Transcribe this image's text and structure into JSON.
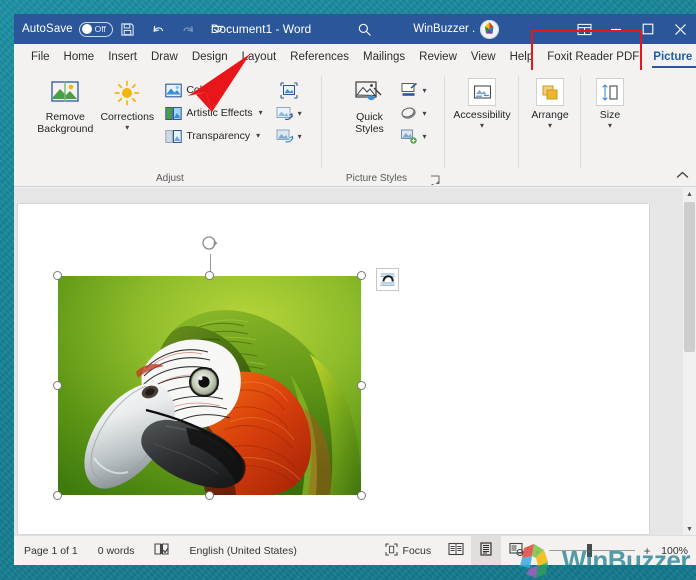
{
  "titlebar": {
    "autosave_label": "AutoSave",
    "autosave_state": "Off",
    "save_icon": "save-icon",
    "undo_icon": "undo-icon",
    "redo_icon": "redo-icon",
    "customize_qat_icon": "chevron-down-icon",
    "document_title": "Document1  -  Word",
    "search_icon": "search-icon",
    "account_name": "WinBuzzer .",
    "ribbon_display_icon": "ribbon-display-options-icon",
    "minimize_icon": "minimize-icon",
    "maximize_icon": "maximize-icon",
    "close_icon": "close-icon"
  },
  "tabs": [
    {
      "label": "File",
      "active": false
    },
    {
      "label": "Home",
      "active": false
    },
    {
      "label": "Insert",
      "active": false
    },
    {
      "label": "Draw",
      "active": false
    },
    {
      "label": "Design",
      "active": false
    },
    {
      "label": "Layout",
      "active": false
    },
    {
      "label": "References",
      "active": false
    },
    {
      "label": "Mailings",
      "active": false
    },
    {
      "label": "Review",
      "active": false
    },
    {
      "label": "View",
      "active": false
    },
    {
      "label": "Help",
      "active": false
    },
    {
      "label": "Foxit Reader PDF",
      "active": false
    },
    {
      "label": "Picture Format",
      "active": true
    }
  ],
  "tabstrip_right": {
    "share_icon": "share-icon",
    "comments_icon": "comments-icon"
  },
  "annotations": {
    "highlight_box_target": "Picture Format",
    "highlight_color": "#e8161b",
    "arrow_color": "#e8161b",
    "arrow_target": "Color"
  },
  "ribbon": {
    "collapse_icon": "chevron-up-icon",
    "groups": [
      {
        "name": "adjust",
        "label": "Adjust",
        "big_buttons": [
          {
            "label": "Remove\nBackground",
            "label_line1": "Remove",
            "label_line2": "Background",
            "icon": "remove-background-icon",
            "has_chevron": false
          },
          {
            "label": "Corrections",
            "icon": "corrections-sun-icon",
            "has_chevron": true
          }
        ],
        "small_buttons": [
          {
            "label": "Color",
            "icon": "color-picture-icon",
            "has_chevron": true
          },
          {
            "label": "Artistic Effects",
            "icon": "artistic-effects-icon",
            "has_chevron": true
          },
          {
            "label": "Transparency",
            "icon": "transparency-icon",
            "has_chevron": true
          }
        ],
        "icon_buttons": [
          {
            "label": "Compress Pictures",
            "icon": "compress-pictures-icon",
            "has_chevron": false
          },
          {
            "label": "Change Picture",
            "icon": "change-picture-icon",
            "has_chevron": true
          },
          {
            "label": "Reset Picture",
            "icon": "reset-picture-icon",
            "has_chevron": true
          }
        ]
      },
      {
        "name": "picture-styles",
        "label": "Picture Styles",
        "has_dialog_launcher": true,
        "dialog_launcher_icon": "dialog-launcher-icon",
        "big_buttons": [
          {
            "label": "Quick\nStyles",
            "label_line1": "Quick",
            "label_line2": "Styles",
            "icon": "quick-styles-icon",
            "has_chevron": true
          }
        ],
        "icon_buttons": [
          {
            "label": "Picture Border",
            "icon": "picture-border-icon",
            "has_chevron": true
          },
          {
            "label": "Picture Effects",
            "icon": "picture-effects-icon",
            "has_chevron": true
          },
          {
            "label": "Picture Layout",
            "icon": "picture-layout-icon",
            "has_chevron": true
          }
        ]
      },
      {
        "name": "accessibility",
        "label": "",
        "big_buttons": [
          {
            "label": "Accessibility",
            "icon": "accessibility-icon",
            "has_chevron": true
          }
        ]
      },
      {
        "name": "arrange",
        "label": "",
        "big_buttons": [
          {
            "label": "Arrange",
            "icon": "arrange-icon",
            "has_chevron": true
          }
        ]
      },
      {
        "name": "size",
        "label": "",
        "big_buttons": [
          {
            "label": "Size",
            "icon": "size-icon",
            "has_chevron": true
          }
        ]
      }
    ]
  },
  "document": {
    "selected_image": "macaw-parrot-photo",
    "layout_options_icon": "layout-options-icon",
    "rotate_handle_icon": "rotate-handle-icon",
    "handle_count": 8
  },
  "statusbar": {
    "page_label": "Page 1 of 1",
    "word_count": "0 words",
    "proofing_icon": "proofing-errors-icon",
    "language": "English (United States)",
    "focus_label": "Focus",
    "focus_icon": "focus-icon",
    "read_mode_icon": "read-mode-icon",
    "print_layout_icon": "print-layout-icon",
    "web_layout_icon": "web-layout-icon",
    "zoom_out": "-",
    "zoom_in": "+",
    "zoom_value": "100%"
  },
  "watermark": {
    "text": "WinBuzzer"
  }
}
